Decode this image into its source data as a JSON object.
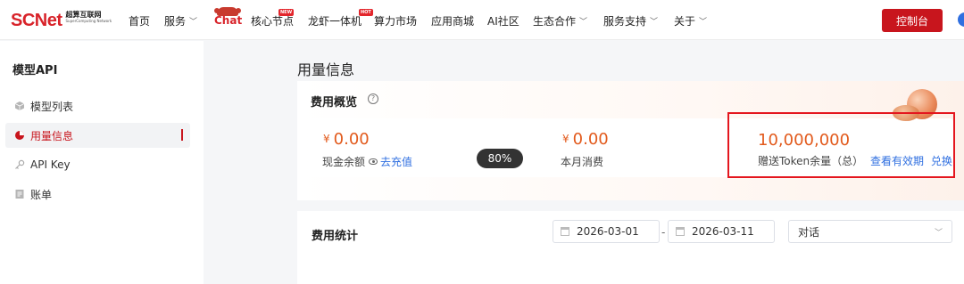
{
  "colors": {
    "brand": "#c8151d",
    "accent_amount": "#e25a1c",
    "link": "#2f6fe0",
    "highlight_box": "#e4161e"
  },
  "logo": {
    "main": "SCNet",
    "cn": "超算互联网",
    "en": "SuperComputing Network"
  },
  "nav": {
    "home": "首页",
    "services": "服务",
    "chat": "Chat",
    "core_nodes": "核心节点",
    "core_nodes_badge": "NEW",
    "lobster": "龙虾一体机",
    "lobster_badge": "HOT",
    "compute_market": "算力市场",
    "app_store": "应用商城",
    "ai_community": "AI社区",
    "ecosystem": "生态合作",
    "support": "服务支持",
    "about": "关于",
    "console": "控制台"
  },
  "sidebar": {
    "title": "模型API",
    "items": [
      {
        "label": "模型列表",
        "icon": "cube-icon"
      },
      {
        "label": "用量信息",
        "icon": "pie-chart-icon",
        "active": true
      },
      {
        "label": "API Key",
        "icon": "key-icon"
      },
      {
        "label": "账单",
        "icon": "bill-icon"
      }
    ]
  },
  "main": {
    "title": "用量信息",
    "overview": {
      "title": "费用概览",
      "cash_balance": "0.00",
      "currency": "¥",
      "cash_label": "现金余额",
      "recharge_link": "去充值",
      "percent": "80%",
      "monthly_spend": "0.00",
      "monthly_label": "本月消费",
      "token_amount": "10,000,000",
      "token_label": "赠送Token余量（总）",
      "validity_link": "查看有效期",
      "redeem_link": "兑换"
    },
    "stats": {
      "title": "费用统计",
      "start_date": "2026-03-01",
      "separator": "-",
      "end_date": "2026-03-11",
      "type_select": "对话"
    }
  }
}
